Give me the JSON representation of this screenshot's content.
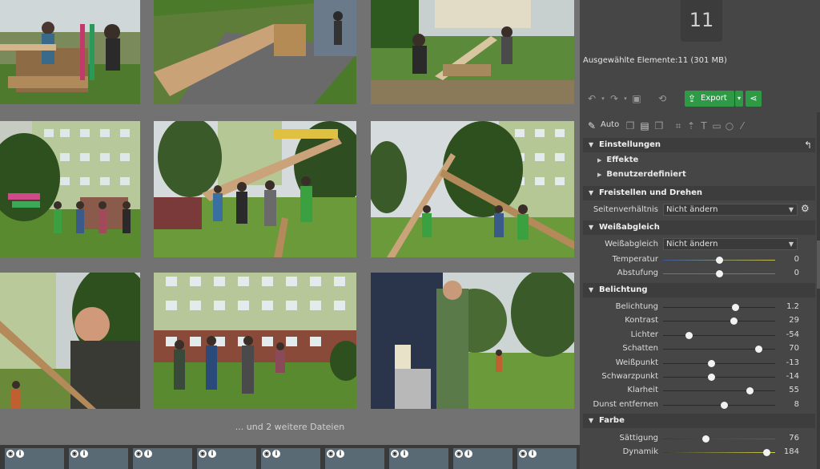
{
  "selection": {
    "count": "11",
    "info": "Ausgewählte Elemente:11 (301 MB)"
  },
  "toolbar": {
    "export_label": "Export",
    "icons": [
      "undo-icon",
      "redo-icon",
      "image-icon",
      "rotate-icon",
      "export-icon",
      "share-icon"
    ]
  },
  "tools": {
    "auto_label": "Auto",
    "icons": [
      "magic-wand-icon",
      "copy-icon",
      "paste-icon",
      "paste-special-icon",
      "crop-icon",
      "straighten-icon",
      "text-icon",
      "rectangle-icon",
      "circle-icon",
      "brush-icon"
    ]
  },
  "grid": {
    "more_files": "... und 2 weitere Dateien"
  },
  "sections": {
    "einstellungen": {
      "title": "Einstellungen",
      "sub": [
        "Effekte",
        "Benutzerdefiniert"
      ]
    },
    "freistellen": {
      "title": "Freistellen und Drehen",
      "ratio_label": "Seitenverhältnis",
      "ratio_value": "Nicht ändern"
    },
    "weissabgleich": {
      "title": "Weißabgleich",
      "wb_label": "Weißabgleich",
      "wb_value": "Nicht ändern",
      "rows": [
        {
          "label": "Temperatur",
          "value": "0",
          "level": 0.5
        },
        {
          "label": "Abstufung",
          "value": "0",
          "level": 0.5
        }
      ]
    },
    "belichtung": {
      "title": "Belichtung",
      "rows": [
        {
          "label": "Belichtung",
          "value": "1.2",
          "level": 0.64
        },
        {
          "label": "Kontrast",
          "value": "29",
          "level": 0.63
        },
        {
          "label": "Lichter",
          "value": "-54",
          "level": 0.23
        },
        {
          "label": "Schatten",
          "value": "70",
          "level": 0.85
        },
        {
          "label": "Weißpunkt",
          "value": "-13",
          "level": 0.43
        },
        {
          "label": "Schwarzpunkt",
          "value": "-14",
          "level": 0.43
        },
        {
          "label": "Klarheit",
          "value": "55",
          "level": 0.77
        },
        {
          "label": "Dunst entfernen",
          "value": "8",
          "level": 0.54
        }
      ]
    },
    "farbe": {
      "title": "Farbe",
      "rows": [
        {
          "label": "Sättigung",
          "value": "76",
          "level": 0.38
        },
        {
          "label": "Dynamik",
          "value": "184",
          "level": 0.92
        }
      ]
    }
  },
  "colors": {
    "accent_green": "#2e9a45",
    "panel_bg": "#464646"
  }
}
